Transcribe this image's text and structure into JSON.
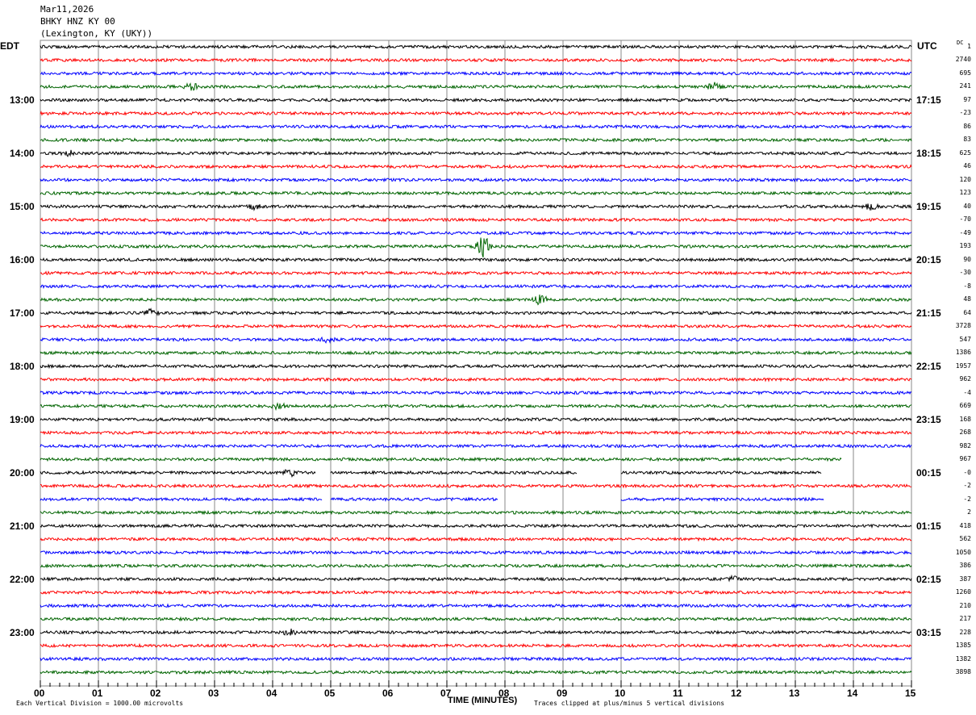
{
  "header": {
    "date": "Mar11,2026",
    "station": "BHKY HNZ KY 00",
    "location": "(Lexington, KY (UKY))"
  },
  "left_zone": "EDT",
  "right_zone": "UTC",
  "dc_label": "DC",
  "footer": {
    "scale": "Each Vertical Division = 1000.00 microvolts",
    "xlabel": "TIME (MINUTES)",
    "clip_note": "Traces clipped at plus/minus 5 vertical divisions"
  },
  "chart_data": {
    "type": "line",
    "title": "",
    "xlabel": "TIME (MINUTES)",
    "xlim": [
      0,
      15
    ],
    "x_ticks": [
      "00",
      "01",
      "02",
      "03",
      "04",
      "05",
      "06",
      "07",
      "08",
      "09",
      "10",
      "11",
      "12",
      "13",
      "14",
      "15"
    ],
    "rows_per_hour": 4,
    "minutes_per_row": 15,
    "colors": [
      "#000000",
      "#ff0000",
      "#0000ff",
      "#006400"
    ],
    "left_labels": [
      "13:00",
      "14:00",
      "15:00",
      "16:00",
      "17:00",
      "18:00",
      "19:00",
      "20:00",
      "21:00",
      "22:00",
      "23:00"
    ],
    "right_labels": [
      "17:15",
      "18:15",
      "19:15",
      "20:15",
      "21:15",
      "22:15",
      "23:15",
      "00:15",
      "01:15",
      "02:15",
      "03:15"
    ],
    "label_first_row": 4,
    "dc_offsets": [
      "1",
      "2740",
      "695",
      "241",
      "97",
      "-23",
      "86",
      "83",
      "625",
      "46",
      "120",
      "123",
      "40",
      "-70",
      "-49",
      "193",
      "90",
      "-30",
      "-8",
      "48",
      "64",
      "3728",
      "547",
      "1386",
      "1957",
      "962",
      "-4",
      "669",
      "168",
      "268",
      "982",
      "967",
      "-0",
      "-2",
      "-2",
      "2",
      "418",
      "562",
      "1050",
      "386",
      "387",
      "1260",
      "210",
      "217",
      "228",
      "1385",
      "1382",
      "3898"
    ],
    "gaps": [
      {
        "row": 31,
        "from": 13.8,
        "to": 15
      },
      {
        "row": 32,
        "from": 4.74,
        "to": 5.0
      },
      {
        "row": 32,
        "from": 9.25,
        "to": 10.0
      },
      {
        "row": 32,
        "from": 13.45,
        "to": 15
      },
      {
        "row": 34,
        "from": 4.86,
        "to": 5.0
      },
      {
        "row": 34,
        "from": 7.88,
        "to": 10.0
      },
      {
        "row": 34,
        "from": 13.5,
        "to": 15
      }
    ],
    "events": [
      {
        "row": 3,
        "minute": 2.6,
        "amp": 5
      },
      {
        "row": 3,
        "minute": 11.6,
        "amp": 6
      },
      {
        "row": 8,
        "minute": 0.5,
        "amp": 4
      },
      {
        "row": 12,
        "minute": 3.7,
        "amp": 4
      },
      {
        "row": 12,
        "minute": 14.3,
        "amp": 4
      },
      {
        "row": 15,
        "minute": 7.63,
        "amp": 16
      },
      {
        "row": 19,
        "minute": 8.6,
        "amp": 7
      },
      {
        "row": 20,
        "minute": 1.9,
        "amp": 5
      },
      {
        "row": 22,
        "minute": 4.95,
        "amp": 4
      },
      {
        "row": 27,
        "minute": 4.1,
        "amp": 4
      },
      {
        "row": 32,
        "minute": 4.3,
        "amp": 5
      },
      {
        "row": 40,
        "minute": 11.9,
        "amp": 4
      },
      {
        "row": 44,
        "minute": 4.3,
        "amp": 5
      }
    ]
  }
}
